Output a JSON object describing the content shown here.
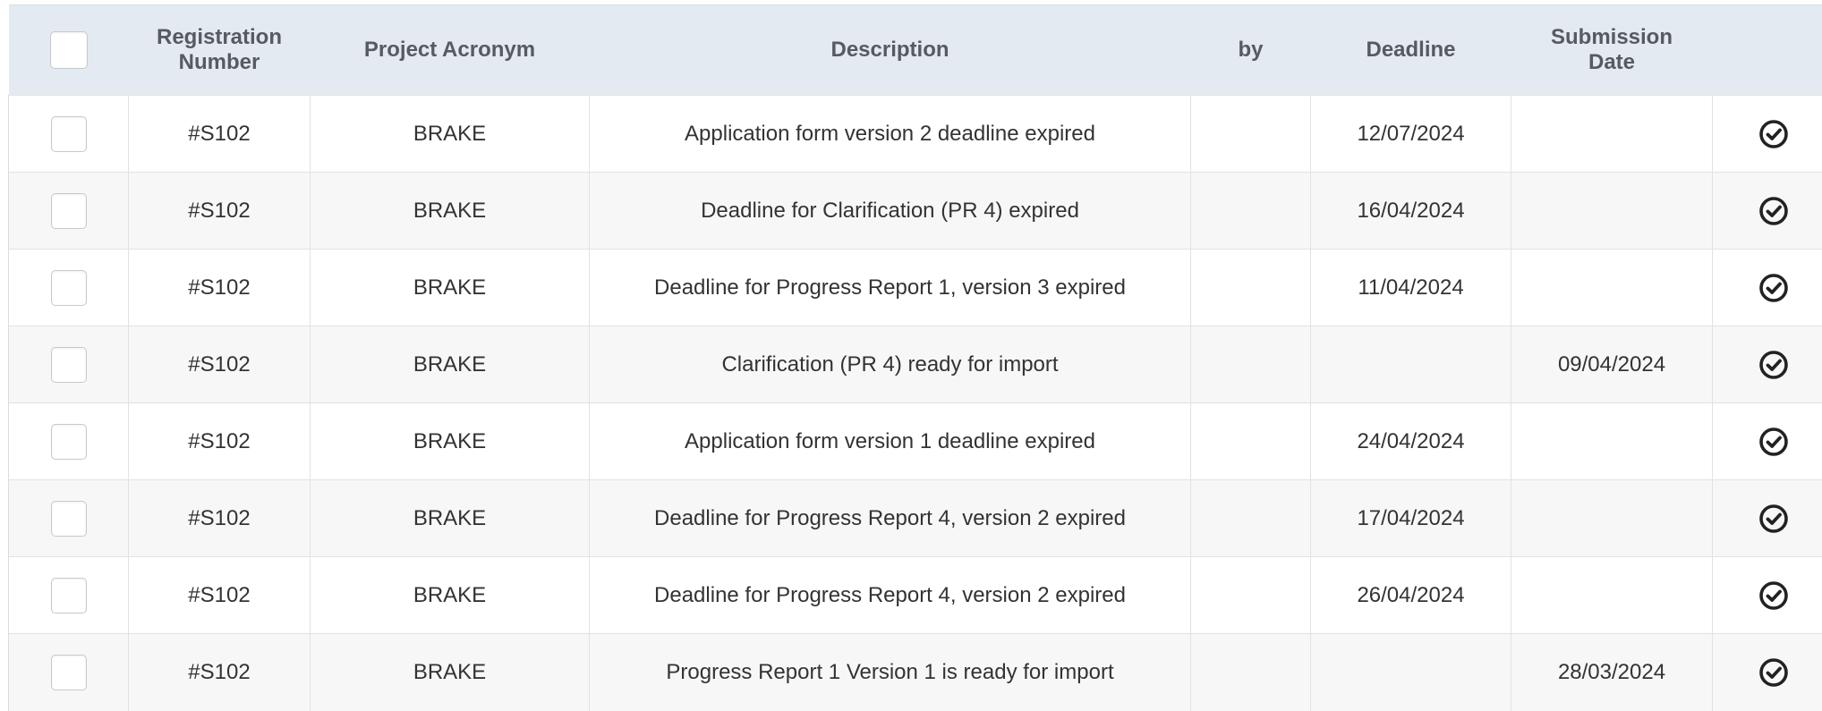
{
  "table": {
    "headers": {
      "registration_number": "Registration\nNumber",
      "project_acronym": "Project Acronym",
      "description": "Description",
      "by": "by",
      "deadline": "Deadline",
      "submission_date": "Submission\nDate"
    },
    "rows": [
      {
        "reg": "#S102",
        "acronym": "BRAKE",
        "description": "Application form version 2 deadline expired",
        "by": "",
        "deadline": "12/07/2024",
        "submission": ""
      },
      {
        "reg": "#S102",
        "acronym": "BRAKE",
        "description": "Deadline for Clarification (PR 4) expired",
        "by": "",
        "deadline": "16/04/2024",
        "submission": ""
      },
      {
        "reg": "#S102",
        "acronym": "BRAKE",
        "description": "Deadline for Progress Report 1, version 3 expired",
        "by": "",
        "deadline": "11/04/2024",
        "submission": ""
      },
      {
        "reg": "#S102",
        "acronym": "BRAKE",
        "description": "Clarification (PR 4) ready for import",
        "by": "",
        "deadline": "",
        "submission": "09/04/2024"
      },
      {
        "reg": "#S102",
        "acronym": "BRAKE",
        "description": "Application form version 1 deadline expired",
        "by": "",
        "deadline": "24/04/2024",
        "submission": ""
      },
      {
        "reg": "#S102",
        "acronym": "BRAKE",
        "description": "Deadline for Progress Report 4, version 2 expired",
        "by": "",
        "deadline": "17/04/2024",
        "submission": ""
      },
      {
        "reg": "#S102",
        "acronym": "BRAKE",
        "description": "Deadline for Progress Report 4, version 2 expired",
        "by": "",
        "deadline": "26/04/2024",
        "submission": ""
      },
      {
        "reg": "#S102",
        "acronym": "BRAKE",
        "description": "Progress Report 1 Version 1 is ready for import",
        "by": "",
        "deadline": "",
        "submission": "28/03/2024"
      }
    ],
    "row_action_icon": "check-circle-icon"
  },
  "colors": {
    "header_bg": "#e4eaf1",
    "header_text": "#555b61",
    "row_alt_bg": "#f7f7f7",
    "body_text": "#333333"
  }
}
